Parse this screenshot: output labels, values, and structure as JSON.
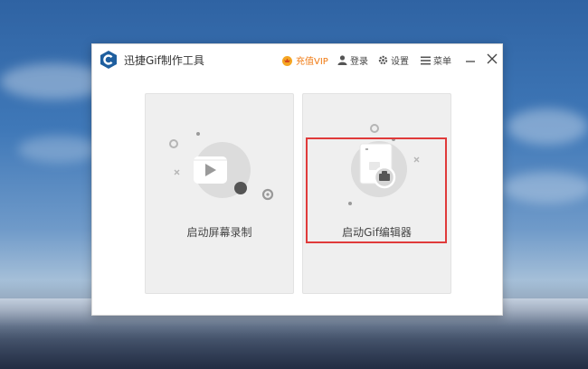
{
  "window": {
    "title": "迅捷Gif制作工具",
    "toolbar": {
      "vip_label": "充值VIP",
      "login_label": "登录",
      "settings_label": "设置",
      "menu_label": "菜单"
    }
  },
  "cards": {
    "screen_record_label": "启动屏幕录制",
    "gif_editor_label": "启动Gif编辑器"
  },
  "colors": {
    "accent": "#f07a12",
    "logo": "#1f5f9f",
    "highlight": "#e03a3a"
  },
  "icons": {
    "logo": "app-logo-icon",
    "vip": "crown-icon",
    "login": "user-icon",
    "settings": "gear-icon",
    "menu": "hamburger-icon",
    "minimize": "minimize-icon",
    "close": "close-icon",
    "record": "video-play-icon",
    "gif": "gif-file-icon"
  }
}
